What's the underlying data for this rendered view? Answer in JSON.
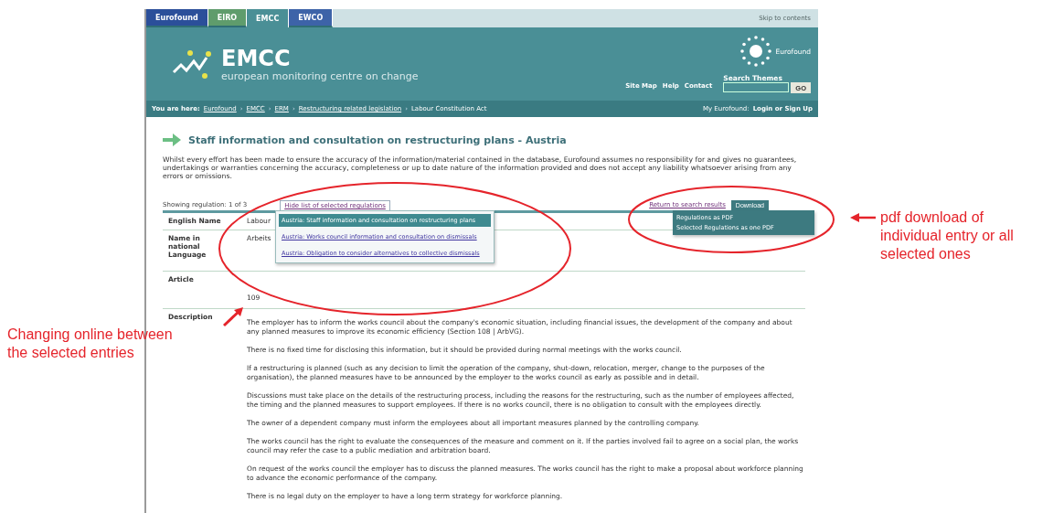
{
  "tabs": [
    {
      "label": "Eurofound",
      "color": "#2b4f9a",
      "selected": false
    },
    {
      "label": "EIRO",
      "color": "#5f9c6c",
      "selected": false
    },
    {
      "label": "EMCC",
      "color": "#4a8f96",
      "selected": true
    },
    {
      "label": "EWCO",
      "color": "#3d63a8",
      "selected": false
    }
  ],
  "skip_link": "Skip to contents",
  "header": {
    "title": "EMCC",
    "subtitle": "european monitoring centre on change",
    "org": "Eurofound",
    "search_label": "Search Themes",
    "search_button": "GO",
    "links": [
      "Site Map",
      "Help",
      "Contact"
    ]
  },
  "breadcrumb": {
    "label": "You are here:",
    "separator": "›",
    "items": [
      "Eurofound",
      "EMCC",
      "ERM",
      "Restructuring related legislation",
      "Labour Constitution Act"
    ],
    "account_label": "My Eurofound:",
    "account_link": "Login or Sign Up"
  },
  "page": {
    "title": "Staff information and consultation on restructuring plans - Austria",
    "disclaimer": "Whilst every effort has been made to ensure the accuracy of the information/material contained in the database, Eurofound assumes no responsibility for and gives no guarantees, undertakings or warranties concerning the accuracy, completeness or up to date nature of the information provided and does not accept any liability whatsoever arising from any errors or omissions.",
    "pager": "Showing regulation: 1 of 3",
    "hide_list_link": "Hide list of selected regulations",
    "return_link": "Return to search results",
    "download_button": "Download"
  },
  "regulation_menu": [
    {
      "label": "Austria: Staff information and consultation on restructuring plans",
      "selected": true
    },
    {
      "label": "Austria: Works council information and consultation on dismissals",
      "selected": false
    },
    {
      "label": "Austria: Obligation to consider alternatives to collective dismissals",
      "selected": false
    }
  ],
  "download_menu": [
    "Regulations as PDF",
    "Selected Regulations as one PDF"
  ],
  "fields": [
    {
      "label": "English Name",
      "value": "Labour"
    },
    {
      "label": "Name in national Language",
      "value": "Arbeits"
    },
    {
      "label": "Article",
      "value": "109"
    }
  ],
  "description": {
    "label": "Description",
    "paragraphs": [
      "The employer has to inform the works council about the company's economic situation, including financial issues, the development of the company and about any planned measures to improve its economic efficiency (Section 108 | ArbVG).",
      "There is no fixed time for disclosing this information, but it should be provided during normal meetings with the works council.",
      "If a restructuring is planned (such as any decision to limit the operation of the company, shut-down, relocation, merger, change to the purposes of the organisation), the planned measures have to be announced by the employer to the works council as early as possible and in detail.",
      "Discussions must take place on the details of the restructuring process, including the reasons for the restructuring, such as the number of employees affected, the timing and the planned measures to support employees. If there is no works council, there is no obligation to consult with the employees directly.",
      "The owner of a dependent company must inform the employees about all important measures planned by the controlling company.",
      "The works council has the right to evaluate the consequences of the measure and comment on it. If the parties involved fail to agree on a social plan, the works council may refer the case to a public mediation and arbitration board.",
      "On request of the works council the employer has to discuss the planned measures. The works council has the right to make a proposal about workforce planning to advance the economic performance of the company.",
      "There is no legal duty on the employer to have a long term strategy for workforce planning."
    ]
  },
  "annotations": {
    "left": "Changing online between the selected entries",
    "right": "pdf download of individual entry or all selected ones"
  }
}
